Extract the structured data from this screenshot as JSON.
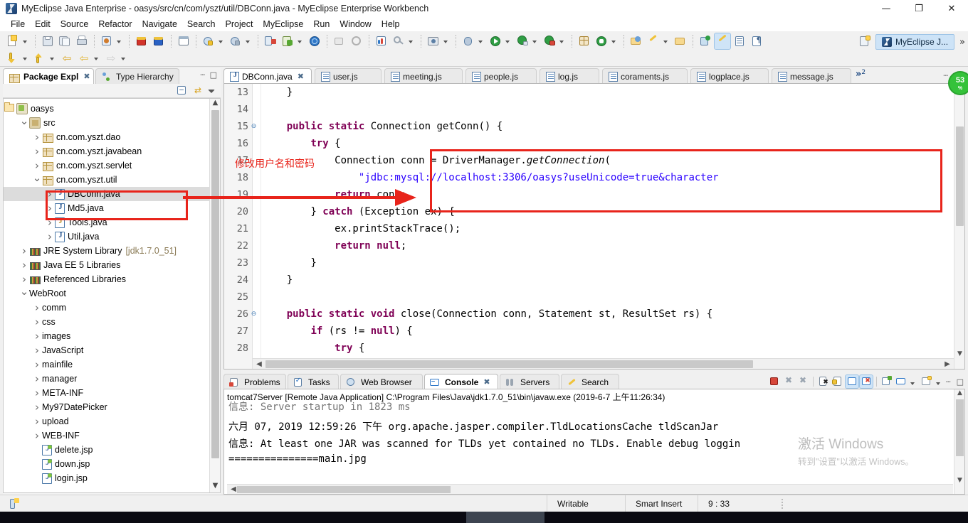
{
  "window": {
    "title": "MyEclipse Java Enterprise - oasys/src/cn/com/yszt/util/DBConn.java - MyEclipse Enterprise Workbench",
    "app_icon": "myeclipse-icon",
    "minimize": "—",
    "maximize": "❐",
    "close": "✕"
  },
  "menubar": {
    "items": [
      {
        "label": "File"
      },
      {
        "label": "Edit"
      },
      {
        "label": "Source"
      },
      {
        "label": "Refactor"
      },
      {
        "label": "Navigate"
      },
      {
        "label": "Search"
      },
      {
        "label": "Project"
      },
      {
        "label": "MyEclipse"
      },
      {
        "label": "Run"
      },
      {
        "label": "Window"
      },
      {
        "label": "Help"
      }
    ]
  },
  "toolbar": {
    "perspective_tab_label": "MyEclipse J...",
    "overflow_label": "»",
    "row1_icons": [
      "new-wizard-icon",
      "new-dropdown-arrow",
      "save-icon",
      "save-all-icon",
      "print-icon",
      "myeclipse-tools-icon",
      "myeclipse-dropdown-arrow",
      "deploy-icon",
      "deploy-add-icon",
      "web-browser-icon",
      "run-server-icon",
      "run-server-arrow",
      "debug-server-icon",
      "debug-server-arrow",
      "export-db-icon",
      "db-explorer-icon",
      "db-explorer-arrow",
      "web-globe-icon",
      "validate-icon",
      "refresh-icon",
      "chart-icon",
      "search-icon",
      "search-arrow",
      "snapshot-icon",
      "snapshot-arrow",
      "debug-icon",
      "debug-arrow",
      "run-icon",
      "run-arrow",
      "run-config-icon",
      "run-config-arrow",
      "lock-run-icon",
      "lock-run-arrow",
      "new-class-icon",
      "new-annotation-icon",
      "new-annotation-arrow",
      "open-type-icon",
      "edit-icon",
      "edit-arrow",
      "open-resource-icon",
      "prev-annotation-icon",
      "next-edit-icon",
      "toggle-block-icon",
      "toggle-mark-icon"
    ],
    "row2_icons": [
      "next-annotation-icon",
      "next-annotation-arrow",
      "prev-annotation-icon",
      "prev-annotation-arrow",
      "back-icon",
      "forward-icon",
      "forward-arrow",
      "next-icon",
      "next-arrow"
    ]
  },
  "sidebar": {
    "tabs": [
      {
        "label": "Package Expl",
        "icon": "package-explorer-icon",
        "active": true,
        "closable": true
      },
      {
        "label": "Type Hierarchy",
        "icon": "type-hierarchy-icon",
        "active": false,
        "closable": false
      }
    ],
    "view_buttons": [
      "collapse-all-icon",
      "link-with-editor-icon",
      "view-menu-icon"
    ],
    "panel_buttons": [
      "minimize-icon",
      "maximize-icon"
    ],
    "tree": [
      {
        "label": "oasys",
        "indent": 0,
        "twisty": "down",
        "icon": "java-project-icon"
      },
      {
        "label": "src",
        "indent": 1,
        "twisty": "down",
        "icon": "source-folder-icon"
      },
      {
        "label": "cn.com.yszt.dao",
        "indent": 2,
        "twisty": "right",
        "icon": "package-icon"
      },
      {
        "label": "cn.com.yszt.javabean",
        "indent": 2,
        "twisty": "right",
        "icon": "package-icon"
      },
      {
        "label": "cn.com.yszt.servlet",
        "indent": 2,
        "twisty": "right",
        "icon": "package-icon"
      },
      {
        "label": "cn.com.yszt.util",
        "indent": 2,
        "twisty": "down",
        "icon": "package-icon"
      },
      {
        "label": "DBConn.java",
        "indent": 3,
        "twisty": "right",
        "icon": "java-file-icon",
        "selected": true
      },
      {
        "label": "Md5.java",
        "indent": 3,
        "twisty": "right",
        "icon": "java-file-icon"
      },
      {
        "label": "Tools.java",
        "indent": 3,
        "twisty": "right",
        "icon": "java-file-warning-icon"
      },
      {
        "label": "Util.java",
        "indent": 3,
        "twisty": "right",
        "icon": "java-file-icon"
      },
      {
        "label": "JRE System Library",
        "indent": 1,
        "twisty": "right",
        "icon": "library-icon",
        "suffix": "[jdk1.7.0_51]"
      },
      {
        "label": "Java EE 5 Libraries",
        "indent": 1,
        "twisty": "right",
        "icon": "library-icon"
      },
      {
        "label": "Referenced Libraries",
        "indent": 1,
        "twisty": "right",
        "icon": "library-icon"
      },
      {
        "label": "WebRoot",
        "indent": 1,
        "twisty": "down",
        "icon": "folder-icon"
      },
      {
        "label": "comm",
        "indent": 2,
        "twisty": "right",
        "icon": "folder-icon"
      },
      {
        "label": "css",
        "indent": 2,
        "twisty": "right",
        "icon": "folder-icon"
      },
      {
        "label": "images",
        "indent": 2,
        "twisty": "right",
        "icon": "folder-icon"
      },
      {
        "label": "JavaScript",
        "indent": 2,
        "twisty": "right",
        "icon": "folder-icon"
      },
      {
        "label": "mainfile",
        "indent": 2,
        "twisty": "right",
        "icon": "folder-icon"
      },
      {
        "label": "manager",
        "indent": 2,
        "twisty": "right",
        "icon": "folder-icon"
      },
      {
        "label": "META-INF",
        "indent": 2,
        "twisty": "right",
        "icon": "folder-icon"
      },
      {
        "label": "My97DatePicker",
        "indent": 2,
        "twisty": "right",
        "icon": "folder-icon"
      },
      {
        "label": "upload",
        "indent": 2,
        "twisty": "right",
        "icon": "folder-icon"
      },
      {
        "label": "WEB-INF",
        "indent": 2,
        "twisty": "right",
        "icon": "folder-icon"
      },
      {
        "label": "delete.jsp",
        "indent": 2,
        "twisty": "none",
        "icon": "jsp-file-icon"
      },
      {
        "label": "down.jsp",
        "indent": 2,
        "twisty": "none",
        "icon": "jsp-file-icon"
      },
      {
        "label": "login.jsp",
        "indent": 2,
        "twisty": "none",
        "icon": "jsp-file-icon"
      }
    ]
  },
  "editor": {
    "tabs": [
      {
        "label": "DBConn.java",
        "icon": "java-file-icon",
        "active": true,
        "closable": true
      },
      {
        "label": "user.js",
        "icon": "js-file-icon",
        "active": false
      },
      {
        "label": "meeting.js",
        "icon": "js-file-icon",
        "active": false
      },
      {
        "label": "people.js",
        "icon": "js-file-icon",
        "active": false
      },
      {
        "label": "log.js",
        "icon": "js-file-icon",
        "active": false
      },
      {
        "label": "coraments.js",
        "icon": "js-file-icon",
        "active": false
      },
      {
        "label": "logplace.js",
        "icon": "js-file-icon",
        "active": false
      },
      {
        "label": "message.js",
        "icon": "js-file-icon",
        "active": false
      }
    ],
    "more_tabs_count": "2",
    "more_tabs_symbol": "»",
    "code_lines": [
      {
        "num": "13",
        "fold": "",
        "text": "    }"
      },
      {
        "num": "14",
        "fold": "",
        "text": ""
      },
      {
        "num": "15",
        "fold": "-",
        "text": "    public static Connection getConn() {"
      },
      {
        "num": "16",
        "fold": "",
        "text": "        try {"
      },
      {
        "num": "17",
        "fold": "",
        "text": "            Connection conn = DriverManager.getConnection("
      },
      {
        "num": "18",
        "fold": "",
        "text": "                \"jdbc:mysql://localhost:3306/oasys?useUnicode=true&character"
      },
      {
        "num": "19",
        "fold": "",
        "text": "            return conn;"
      },
      {
        "num": "20",
        "fold": "",
        "text": "        } catch (Exception ex) {"
      },
      {
        "num": "21",
        "fold": "",
        "text": "            ex.printStackTrace();"
      },
      {
        "num": "22",
        "fold": "",
        "text": "            return null;"
      },
      {
        "num": "23",
        "fold": "",
        "text": "        }"
      },
      {
        "num": "24",
        "fold": "",
        "text": "    }"
      },
      {
        "num": "25",
        "fold": "",
        "text": ""
      },
      {
        "num": "26",
        "fold": "-",
        "text": "    public static void close(Connection conn, Statement st, ResultSet rs) {"
      },
      {
        "num": "27",
        "fold": "",
        "text": "        if (rs != null) {"
      },
      {
        "num": "28",
        "fold": "",
        "text": "            try {"
      }
    ],
    "annotation_text": "修改用户名和密码",
    "annotation_color": "#e8241b"
  },
  "console_panel": {
    "tabs": [
      {
        "label": "Problems",
        "icon": "problems-icon",
        "active": false
      },
      {
        "label": "Tasks",
        "icon": "tasks-icon",
        "active": false
      },
      {
        "label": "Web Browser",
        "icon": "web-browser-icon",
        "active": false
      },
      {
        "label": "Console",
        "icon": "console-icon",
        "active": true,
        "closable": true
      },
      {
        "label": "Servers",
        "icon": "servers-icon",
        "active": false
      },
      {
        "label": "Search",
        "icon": "search-icon",
        "active": false
      }
    ],
    "tool_icons": [
      "terminate-icon",
      "remove-launch-icon",
      "remove-all-launches-icon",
      "clear-console-icon",
      "scroll-lock-icon",
      "word-wrap-icon",
      "pin-console-icon",
      "new-console-view-icon",
      "display-console-icon",
      "display-console-arrow",
      "open-console-icon",
      "open-console-arrow",
      "minimize-icon",
      "maximize-icon"
    ],
    "header": "tomcat7Server [Remote Java Application] C:\\Program Files\\Java\\jdk1.7.0_51\\bin\\javaw.exe (2019-6-7 上午11:26:34)",
    "lines": [
      "信息: Server startup in 1823 ms",
      "六月 07, 2019 12:59:26 下午 org.apache.jasper.compiler.TldLocationsCache tldScanJar",
      "信息: At least one JAR was scanned for TLDs yet contained no TLDs. Enable debug loggin",
      "===============main.jpg"
    ]
  },
  "statusbar": {
    "icon": "smart-insert-icon",
    "writable": "Writable",
    "insert_mode": "Smart Insert",
    "cursor_position": "9 : 33"
  },
  "watermark": {
    "line1": "激活 Windows",
    "line2": "转到\"设置\"以激活 Windows。"
  },
  "colors": {
    "annotation_red": "#e8241b",
    "keyword": "#7f0055",
    "string": "#2a00ff",
    "active_tab_bg": "#ffffff",
    "toolbar_bg": "#f1f1f1"
  }
}
